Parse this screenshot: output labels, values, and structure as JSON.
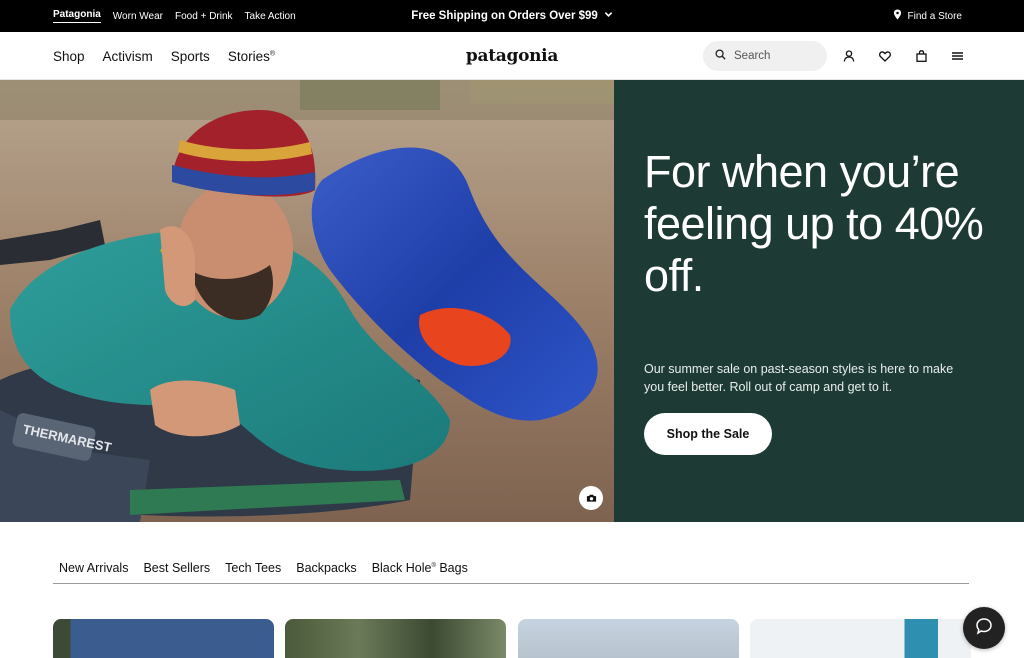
{
  "topbar": {
    "brands": [
      "Patagonia",
      "Worn Wear",
      "Food + Drink",
      "Take Action"
    ],
    "promo": "Free Shipping on Orders Over $99",
    "store": "Find a Store"
  },
  "nav": {
    "links": [
      "Shop",
      "Activism",
      "Sports",
      "Stories"
    ],
    "stories_mark": "®",
    "logo": "patagonia",
    "search_placeholder": "Search"
  },
  "hero": {
    "headline": "For when you’re feeling up to 40% off.",
    "subtext": "Our summer sale on past-season styles is here to make you feel better. Roll out of camp and get to it.",
    "cta": "Shop the Sale",
    "photo_label": "THERMAREST",
    "panel_color": "#1d3a35"
  },
  "categories": {
    "items": [
      "New Arrivals",
      "Best Sellers",
      "Tech Tees",
      "Backpacks",
      "Black Hole"
    ],
    "black_hole_mark": "®",
    "black_hole_suffix": "Bags"
  },
  "icons": [
    "chevron-down-icon",
    "location-pin-icon",
    "search-icon",
    "account-icon",
    "heart-icon",
    "bag-icon",
    "menu-icon",
    "camera-icon",
    "chat-icon"
  ]
}
